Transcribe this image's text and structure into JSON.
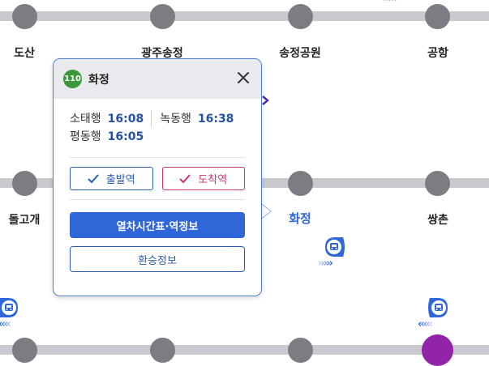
{
  "map": {
    "top_row": [
      "도산",
      "광주송정",
      "송정공원",
      "공항"
    ],
    "middle_row": [
      "돌고개",
      "화정",
      "쌍촌"
    ]
  },
  "popup": {
    "line_number": "110",
    "line_color": "#3a9a3b",
    "station_name": "화정",
    "departures": [
      {
        "direction": "소태행",
        "time": "16:08"
      },
      {
        "direction": "녹동행",
        "time": "16:38"
      },
      {
        "direction": "평동행",
        "time": "16:05"
      }
    ],
    "depart_label": "출발역",
    "arrive_label": "도착역",
    "timetable_label": "열차시간표·역정보",
    "transfer_label": "환승정보"
  },
  "colors": {
    "accent": "#2f66d8",
    "arrive": "#c9356c",
    "track": "#c9cace",
    "station": "#7c7d82",
    "terminal": "#9224a8"
  }
}
